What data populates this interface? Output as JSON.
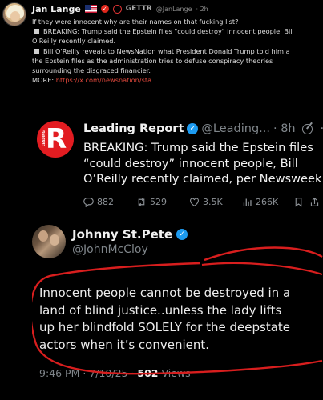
{
  "post": {
    "author_name": "Jan Lange",
    "flag_icon": "us-flag-icon",
    "platform": "GETTR",
    "handle": "@JanLange",
    "time": "· 2h",
    "lines": [
      "If they were innocent why are their names on that fucking list?",
      "BREAKING: Trump said the Epstein files \"could destroy\" innocent people, Bill",
      "O'Reilly recently claimed.",
      "Bill O'Reilly reveals to NewsNation what President Donald Trump told him a",
      "the Epstein files as the administration tries to defuse conspiracy theories",
      "surrounding the disgraced financier."
    ],
    "more_label": "MORE:",
    "more_link": "https://x.com/newsnation/sta..."
  },
  "quote1": {
    "logo_letter": "R",
    "logo_label": "LEADING",
    "name": "Leading Report",
    "handle": "@Leading...",
    "time": "· 8h",
    "text_lines": [
      "BREAKING: Trump said the Epstein files",
      "“could destroy” innocent people, Bill",
      "O’Reilly recently claimed, per Newsweek."
    ],
    "replies": "882",
    "reposts": "529",
    "likes": "3.5K",
    "views": "266K"
  },
  "quote2": {
    "name": "Johnny St.Pete",
    "handle": "@JohnMcCloy",
    "text_lines": [
      "Innocent people cannot be destroyed in a",
      "land of blind justice..unless the lady lifts",
      "up her blindfold SOLELY for the deepstate",
      "actors when it’s convenient."
    ],
    "time": "9:46 PM · 7/10/25 · ",
    "views_count": "502",
    "views_label": " Views"
  },
  "colors": {
    "accent_red": "#e0271c",
    "verified_blue": "#1d9bf0",
    "link_red": "#e0483c"
  }
}
